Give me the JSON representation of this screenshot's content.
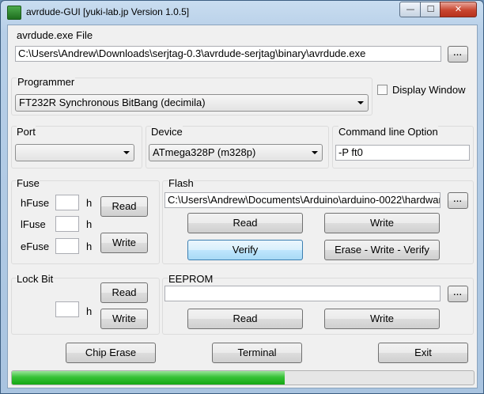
{
  "window": {
    "title": "avrdude-GUI [yuki-lab.jp Version 1.0.5]",
    "min_symbol": "—",
    "max_symbol": "☐",
    "close_symbol": "✕"
  },
  "avrdude": {
    "label": "avrdude.exe File",
    "path": "C:\\Users\\Andrew\\Downloads\\serjtag-0.3\\avrdude-serjtag\\binary\\avrdude.exe",
    "browse_label": "..."
  },
  "programmer": {
    "label": "Programmer",
    "selected": "FT232R Synchronous BitBang (decimila)"
  },
  "display_window": {
    "label": "Display Window",
    "checked": false
  },
  "port": {
    "label": "Port",
    "selected": ""
  },
  "device": {
    "label": "Device",
    "selected": "ATmega328P (m328p)"
  },
  "cmdline": {
    "label": "Command line Option",
    "value": "-P ft0"
  },
  "fuse": {
    "label": "Fuse",
    "hfuse_label": "hFuse",
    "lfuse_label": "lFuse",
    "efuse_label": "eFuse",
    "hfuse_value": "",
    "lfuse_value": "",
    "efuse_value": "",
    "unit": "h",
    "read_label": "Read",
    "write_label": "Write"
  },
  "flash": {
    "label": "Flash",
    "path": "C:\\Users\\Andrew\\Documents\\Arduino\\arduino-0022\\hardwar",
    "browse_label": "...",
    "read_label": "Read",
    "write_label": "Write",
    "verify_label": "Verify",
    "erase_write_verify_label": "Erase - Write - Verify"
  },
  "lockbit": {
    "label": "Lock Bit",
    "value": "",
    "unit": "h",
    "read_label": "Read",
    "write_label": "Write"
  },
  "eeprom": {
    "label": "EEPROM",
    "path": "",
    "browse_label": "...",
    "read_label": "Read",
    "write_label": "Write"
  },
  "actions": {
    "chip_erase_label": "Chip Erase",
    "terminal_label": "Terminal",
    "exit_label": "Exit"
  },
  "progress": {
    "value": 0.59
  },
  "colors": {
    "progress_green": "#37c237",
    "hover_blue": "#bee6fd"
  }
}
